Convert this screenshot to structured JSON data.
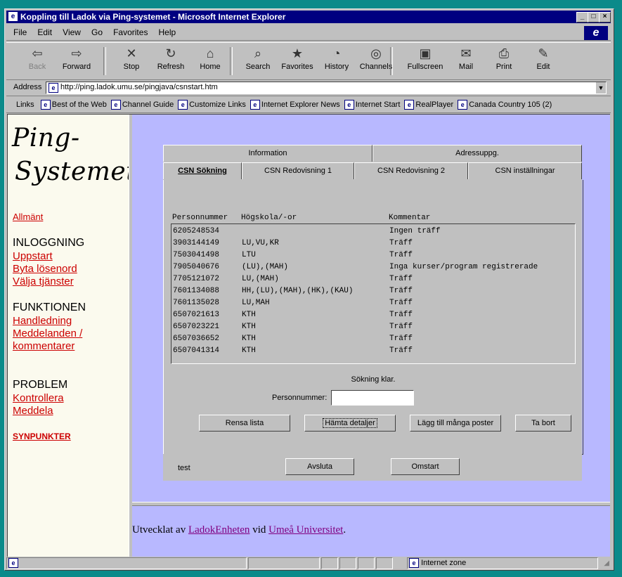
{
  "window": {
    "title": "Koppling till Ladok via Ping-systemet - Microsoft Internet Explorer",
    "controls": [
      "_",
      "□",
      "×"
    ]
  },
  "menu": [
    "File",
    "Edit",
    "View",
    "Go",
    "Favorites",
    "Help"
  ],
  "toolbar": [
    {
      "label": "Back",
      "icon": "back-arrow-icon",
      "glyph": "⇦",
      "disabled": true
    },
    {
      "label": "Forward",
      "icon": "forward-arrow-icon",
      "glyph": "⇨",
      "disabled": false
    },
    {
      "label": "Stop",
      "icon": "stop-icon",
      "glyph": "✕",
      "disabled": false
    },
    {
      "label": "Refresh",
      "icon": "refresh-icon",
      "glyph": "↻",
      "disabled": false
    },
    {
      "label": "Home",
      "icon": "home-icon",
      "glyph": "⌂",
      "disabled": false
    },
    {
      "label": "Search",
      "icon": "search-icon",
      "glyph": "⌕",
      "disabled": false
    },
    {
      "label": "Favorites",
      "icon": "favorites-icon",
      "glyph": "★",
      "disabled": false
    },
    {
      "label": "History",
      "icon": "history-icon",
      "glyph": "◔",
      "disabled": false
    },
    {
      "label": "Channels",
      "icon": "channels-icon",
      "glyph": "◎",
      "disabled": false
    },
    {
      "label": "Fullscreen",
      "icon": "fullscreen-icon",
      "glyph": "▣",
      "disabled": false
    },
    {
      "label": "Mail",
      "icon": "mail-icon",
      "glyph": "✉",
      "disabled": false
    },
    {
      "label": "Print",
      "icon": "print-icon",
      "glyph": "⎙",
      "disabled": false
    },
    {
      "label": "Edit",
      "icon": "edit-icon",
      "glyph": "✎",
      "disabled": false
    }
  ],
  "address": {
    "label": "Address",
    "url": "http://ping.ladok.umu.se/pingjava/csnstart.htm"
  },
  "links": {
    "label": "Links",
    "items": [
      "Best of the Web",
      "Channel Guide",
      "Customize Links",
      "Internet Explorer News",
      "Internet Start",
      "RealPlayer",
      "Canada Country 105  (2)"
    ]
  },
  "sidebar": {
    "logo_line1": "Ping-",
    "logo_line2": "Systemet",
    "allmant": "Allmänt",
    "inloggning_heading": "INLOGGNING",
    "inloggning_links": [
      "Uppstart",
      "Byta lösenord",
      "Välja tjänster"
    ],
    "funktionen_heading": "FUNKTIONEN",
    "funktionen_links": [
      "Handledning",
      "Meddelanden /",
      "kommentarer"
    ],
    "problem_heading": "PROBLEM",
    "problem_links": [
      "Kontrollera",
      "Meddela"
    ],
    "synpunkter": "SYNPUNKTER"
  },
  "applet": {
    "tabs_row1": [
      "Information",
      "Adressuppg."
    ],
    "tabs_row2": [
      "CSN Sökning",
      "CSN Redovisning 1",
      "CSN Redovisning 2",
      "CSN inställningar"
    ],
    "selected_tab": "CSN Sökning",
    "columns": [
      "Personnummer",
      "Högskola/-or",
      "Kommentar"
    ],
    "rows": [
      [
        "6205248534",
        "",
        "Ingen träff"
      ],
      [
        "3903144149",
        "LU,VU,KR",
        "Träff"
      ],
      [
        "7503041498",
        "LTU",
        "Träff"
      ],
      [
        "7905040676",
        "(LU),(MAH)",
        "Inga kurser/program registrerade"
      ],
      [
        "7705121072",
        "LU,(MAH)",
        "Träff"
      ],
      [
        "7601134088",
        "HH,(LU),(MAH),(HK),(KAU)",
        "Träff"
      ],
      [
        "7601135028",
        "LU,MAH",
        "Träff"
      ],
      [
        "6507021613",
        "KTH",
        "Träff"
      ],
      [
        "6507023221",
        "KTH",
        "Träff"
      ],
      [
        "6507036652",
        "KTH",
        "Träff"
      ],
      [
        "6507041314",
        "KTH",
        "Träff"
      ]
    ],
    "status": "Sökning klar.",
    "pnr_label": "Personnummer:",
    "pnr_value": "",
    "buttons": [
      "Rensa lista",
      "Hämta detaljer",
      "Lägg till många poster",
      "Ta bort"
    ],
    "footer_text": "test",
    "footer_buttons": [
      "Avsluta",
      "Omstart"
    ]
  },
  "footer": {
    "prefix": "Utvecklat av ",
    "link1": "LadokEnheten",
    "middle": " vid ",
    "link2": "Umeå Universitet",
    "suffix": "."
  },
  "statusbar": {
    "zone": "Internet zone"
  },
  "colors": {
    "desktop": "#0b8a8a",
    "titlebar": "#000080",
    "frame_bg": "#b8b8ff",
    "link_red": "#cc0000"
  }
}
